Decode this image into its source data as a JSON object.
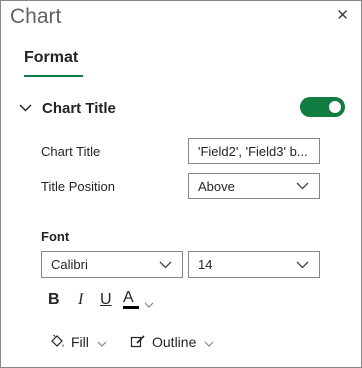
{
  "pane": {
    "title": "Chart",
    "close_glyph": "✕"
  },
  "tabs": [
    {
      "label": "Format",
      "active": true
    }
  ],
  "section": {
    "label": "Chart Title",
    "expanded": true,
    "toggle_on": true
  },
  "fields": {
    "chart_title": {
      "label": "Chart Title",
      "value": "'Field2', 'Field3' b..."
    },
    "title_position": {
      "label": "Title Position",
      "value": "Above"
    }
  },
  "font": {
    "heading": "Font",
    "family": "Calibri",
    "size": "14",
    "bold_glyph": "B",
    "italic_glyph": "I",
    "underline_glyph": "U",
    "color_glyph": "A",
    "color_bar": "#000000"
  },
  "bottom": {
    "fill_label": "Fill",
    "outline_label": "Outline"
  },
  "colors": {
    "accent": "#107c41"
  }
}
